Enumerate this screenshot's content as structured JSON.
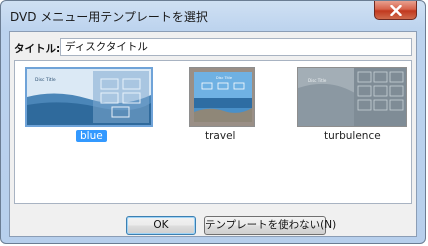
{
  "window": {
    "title": "DVD メニュー用テンプレートを選択"
  },
  "title_field": {
    "label": "タイトル:",
    "value": "ディスクタイトル"
  },
  "templates": [
    {
      "name": "blue",
      "selected": true,
      "thumb_text": "Disc Title"
    },
    {
      "name": "travel",
      "selected": false,
      "thumb_text": "Disc Title"
    },
    {
      "name": "turbulence",
      "selected": false,
      "thumb_text": "Disc Title"
    }
  ],
  "buttons": {
    "ok": "OK",
    "no_template": "テンプレートを使わない(N)"
  },
  "colors": {
    "selection": "#3399ff",
    "title_bar": "#bcd3ee",
    "close_button": "#c1391f"
  }
}
